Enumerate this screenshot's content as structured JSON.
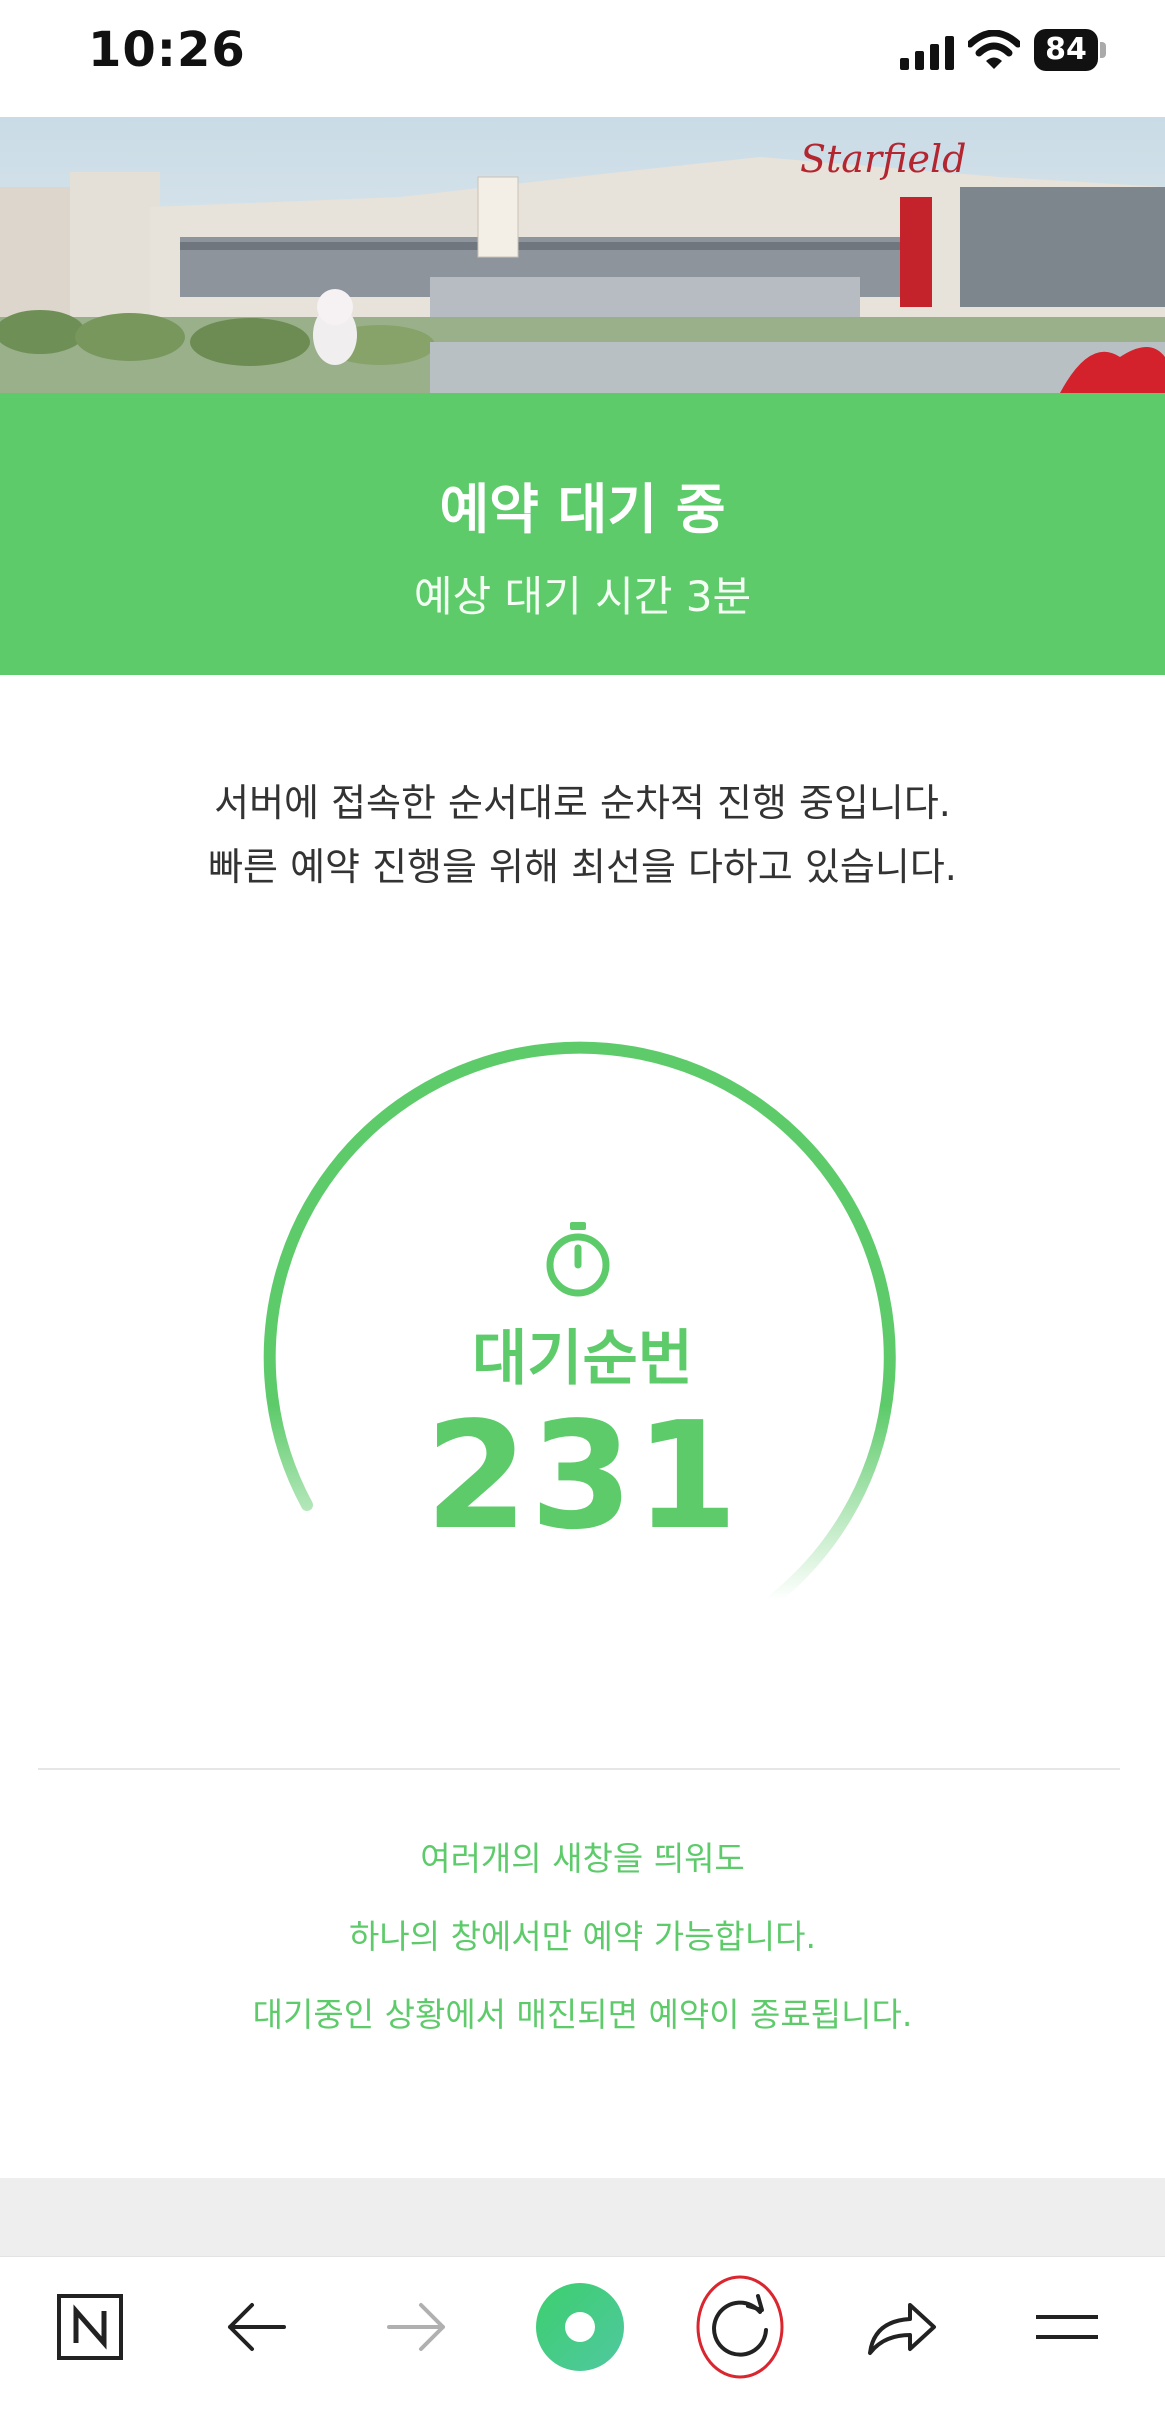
{
  "status_bar": {
    "time": "10:26",
    "battery": "84"
  },
  "banner": {
    "title": "예약 대기 중",
    "subtitle": "예상 대기 시간 3분"
  },
  "notice": {
    "line1": "서버에 접속한 순서대로 순차적 진행 중입니다.",
    "line2": "빠른 예약 진행을 위해 최선을 다하고 있습니다."
  },
  "queue": {
    "label": "대기순번",
    "number": "231"
  },
  "warnings": [
    "여러개의 새창을 띄워도",
    "하나의 창에서만 예약 가능합니다.",
    "대기중인 상황에서 매진되면 예약이 종료됩니다."
  ],
  "colors": {
    "accent": "#5ecb6b",
    "highlight_circle": "#d9262f"
  },
  "toolbar": {
    "icons": [
      "naver-icon",
      "back-arrow-icon",
      "forward-arrow-icon",
      "home-dot-icon",
      "reload-icon",
      "share-icon",
      "menu-icon"
    ]
  }
}
